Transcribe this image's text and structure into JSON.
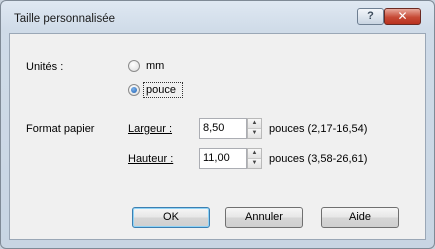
{
  "dialog": {
    "title": "Taille personnalisée",
    "help_glyph": "?",
    "close_glyph": "✕"
  },
  "units": {
    "label": "Unités :",
    "options": [
      {
        "label": "mm",
        "selected": false
      },
      {
        "label": "pouce",
        "selected": true
      }
    ]
  },
  "paper_format": {
    "label": "Format papier",
    "width": {
      "label": "Largeur :",
      "value": "8,50",
      "range": "pouces (2,17-16,54)"
    },
    "height": {
      "label": "Hauteur :",
      "value": "11,00",
      "range": "pouces (3,58-26,61)"
    }
  },
  "buttons": {
    "ok": "OK",
    "cancel": "Annuler",
    "help": "Aide"
  },
  "spin_icons": {
    "up": "▲",
    "down": "▼"
  }
}
